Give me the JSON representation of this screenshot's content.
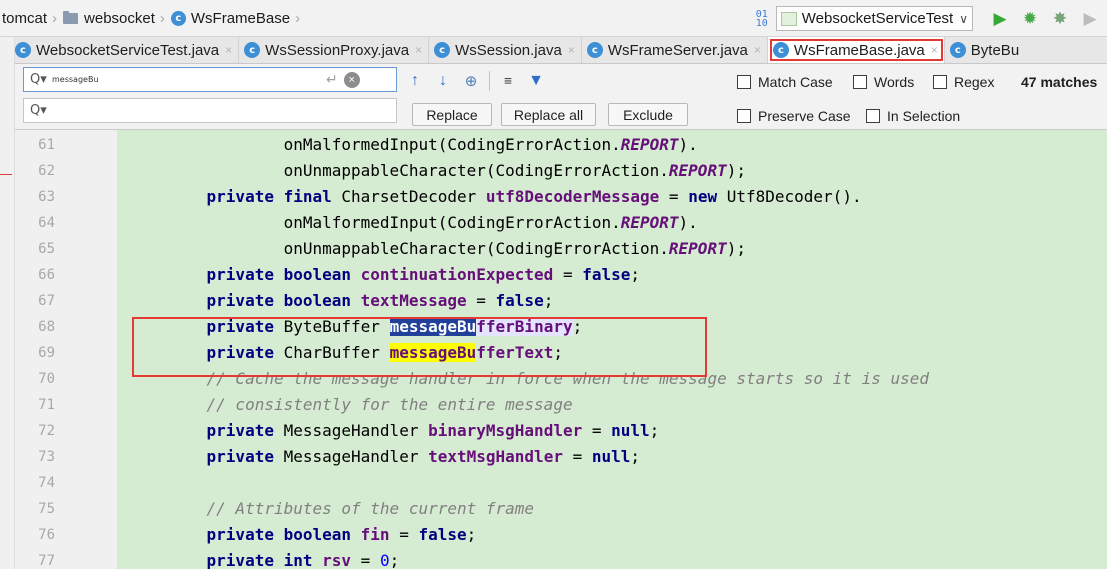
{
  "breadcrumb": {
    "items": [
      {
        "label": "tomcat",
        "icon": "none"
      },
      {
        "label": "websocket",
        "icon": "folder-icon"
      },
      {
        "label": "WsFrameBase",
        "icon": "class-icon"
      }
    ],
    "separator": "›",
    "class_icon_glyph": "c"
  },
  "toolbar": {
    "sort_icon_top": "01",
    "sort_icon_bottom": "10",
    "run_config": "WebsocketServiceTest",
    "chevron": "∨",
    "run_icon": "▶",
    "debug_icon": "✹",
    "coverage_icon": "✸",
    "more_icon": "▶"
  },
  "tabs": {
    "left_arrow": "←",
    "close_glyph": "×",
    "items": [
      {
        "label": "WebsocketServiceTest.java",
        "icon_glyph": "c",
        "icon_color": "#3d8fd6"
      },
      {
        "label": "WsSessionProxy.java",
        "icon_glyph": "c",
        "icon_color": "#3d8fd6"
      },
      {
        "label": "WsSession.java",
        "icon_glyph": "c",
        "icon_color": "#3d8fd6"
      },
      {
        "label": "WsFrameServer.java",
        "icon_glyph": "c",
        "icon_color": "#3d8fd6"
      },
      {
        "label": "WsFrameBase.java",
        "icon_glyph": "c",
        "icon_color": "#3d8fd6"
      },
      {
        "label": "ByteBu",
        "icon_glyph": "c",
        "icon_color": "#3d8fd6"
      }
    ],
    "active_index": 4
  },
  "find": {
    "search_icon": "Q▾",
    "search_value": "messageBu",
    "enter_icon": "↵",
    "clear_icon": "×",
    "replace_icon": "Q▾",
    "replace_value": "",
    "tool_up": "↑",
    "tool_down": "↓",
    "tool_search_all": "⊕",
    "tool_select": "≡",
    "tool_filter": "▼",
    "replace_label": "Replace",
    "replace_all_label": "Replace all",
    "exclude_label": "Exclude",
    "match_case": "Match Case",
    "words": "Words",
    "regex": "Regex",
    "preserve_case": "Preserve Case",
    "in_selection": "In Selection",
    "matches": "47 matches"
  },
  "editor": {
    "highlight_color": "#d6ecd2",
    "lines": [
      {
        "no": "61",
        "segs": [
          {
            "t": "            onMalformedInput(CodingErrorAction.",
            "c": ""
          },
          {
            "t": "REPORT",
            "c": "cst"
          },
          {
            "t": ").",
            "c": ""
          }
        ]
      },
      {
        "no": "62",
        "segs": [
          {
            "t": "            onUnmappableCharacter(CodingErrorAction.",
            "c": ""
          },
          {
            "t": "REPORT",
            "c": "cst"
          },
          {
            "t": ");",
            "c": ""
          }
        ]
      },
      {
        "no": "63",
        "segs": [
          {
            "t": "    ",
            "c": ""
          },
          {
            "t": "private final ",
            "c": "kw"
          },
          {
            "t": "CharsetDecoder ",
            "c": ""
          },
          {
            "t": "utf8DecoderMessage",
            "c": "fld"
          },
          {
            "t": " = ",
            "c": ""
          },
          {
            "t": "new ",
            "c": "kw"
          },
          {
            "t": "Utf8Decoder().",
            "c": ""
          }
        ]
      },
      {
        "no": "64",
        "segs": [
          {
            "t": "            onMalformedInput(CodingErrorAction.",
            "c": ""
          },
          {
            "t": "REPORT",
            "c": "cst"
          },
          {
            "t": ").",
            "c": ""
          }
        ]
      },
      {
        "no": "65",
        "segs": [
          {
            "t": "            onUnmappableCharacter(CodingErrorAction.",
            "c": ""
          },
          {
            "t": "REPORT",
            "c": "cst"
          },
          {
            "t": ");",
            "c": ""
          }
        ]
      },
      {
        "no": "66",
        "segs": [
          {
            "t": "    ",
            "c": ""
          },
          {
            "t": "private boolean ",
            "c": "kw"
          },
          {
            "t": "continuationExpected",
            "c": "fld"
          },
          {
            "t": " = ",
            "c": ""
          },
          {
            "t": "false",
            "c": "kw"
          },
          {
            "t": ";",
            "c": ""
          }
        ]
      },
      {
        "no": "67",
        "segs": [
          {
            "t": "    ",
            "c": ""
          },
          {
            "t": "private boolean ",
            "c": "kw"
          },
          {
            "t": "textMessage",
            "c": "fld"
          },
          {
            "t": " = ",
            "c": ""
          },
          {
            "t": "false",
            "c": "kw"
          },
          {
            "t": ";",
            "c": ""
          }
        ]
      },
      {
        "no": "68",
        "segs": [
          {
            "t": "    ",
            "c": ""
          },
          {
            "t": "private ",
            "c": "kw"
          },
          {
            "t": "ByteBuffer ",
            "c": ""
          },
          {
            "t": "messageBu",
            "c": "fld hl-cur"
          },
          {
            "t": "fferBinary",
            "c": "fld hl-rest"
          },
          {
            "t": ";",
            "c": ""
          }
        ]
      },
      {
        "no": "69",
        "segs": [
          {
            "t": "    ",
            "c": ""
          },
          {
            "t": "private ",
            "c": "kw"
          },
          {
            "t": "CharBuffer ",
            "c": ""
          },
          {
            "t": "messageBu",
            "c": "fld hl-match"
          },
          {
            "t": "fferText",
            "c": "fld"
          },
          {
            "t": ";",
            "c": ""
          }
        ]
      },
      {
        "no": "70",
        "segs": [
          {
            "t": "    // Cache the message handler in force when the message starts so it is used",
            "c": "cmt"
          }
        ]
      },
      {
        "no": "71",
        "segs": [
          {
            "t": "    // consistently for the entire message",
            "c": "cmt"
          }
        ]
      },
      {
        "no": "72",
        "segs": [
          {
            "t": "    ",
            "c": ""
          },
          {
            "t": "private ",
            "c": "kw"
          },
          {
            "t": "MessageHandler ",
            "c": ""
          },
          {
            "t": "binaryMsgHandler",
            "c": "fld"
          },
          {
            "t": " = ",
            "c": ""
          },
          {
            "t": "null",
            "c": "kw"
          },
          {
            "t": ";",
            "c": ""
          }
        ]
      },
      {
        "no": "73",
        "segs": [
          {
            "t": "    ",
            "c": ""
          },
          {
            "t": "private ",
            "c": "kw"
          },
          {
            "t": "MessageHandler ",
            "c": ""
          },
          {
            "t": "textMsgHandler",
            "c": "fld"
          },
          {
            "t": " = ",
            "c": ""
          },
          {
            "t": "null",
            "c": "kw"
          },
          {
            "t": ";",
            "c": ""
          }
        ]
      },
      {
        "no": "74",
        "segs": []
      },
      {
        "no": "75",
        "segs": [
          {
            "t": "    // Attributes of the current frame",
            "c": "cmt"
          }
        ]
      },
      {
        "no": "76",
        "segs": [
          {
            "t": "    ",
            "c": ""
          },
          {
            "t": "private boolean ",
            "c": "kw"
          },
          {
            "t": "fin",
            "c": "fld"
          },
          {
            "t": " = ",
            "c": ""
          },
          {
            "t": "false",
            "c": "kw"
          },
          {
            "t": ";",
            "c": ""
          }
        ]
      },
      {
        "no": "77",
        "segs": [
          {
            "t": "    ",
            "c": ""
          },
          {
            "t": "private int ",
            "c": "kw"
          },
          {
            "t": "rsv",
            "c": "fld"
          },
          {
            "t": " = ",
            "c": ""
          },
          {
            "t": "0",
            "c": "num"
          },
          {
            "t": ";",
            "c": ""
          }
        ]
      }
    ]
  }
}
